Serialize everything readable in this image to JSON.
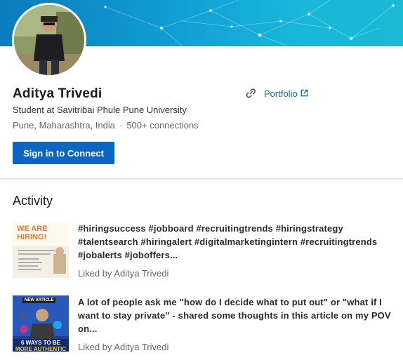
{
  "profile": {
    "name": "Aditya Trivedi",
    "headline": "Student at Savitribai Phule Pune University",
    "location": "Pune, Maharashtra, India",
    "separator": "·",
    "connections": "500+ connections",
    "portfolio_label": "Portfolio",
    "sign_in_label": "Sign in to Connect"
  },
  "activity": {
    "title": "Activity",
    "items": [
      {
        "text": "#hiringsuccess #jobboard #recruitingtrends #hiringstrategy #talentsearch #hiringalert #digitalmarketingintern #recruitingtrends #jobalerts #joboffers...",
        "liked_by": "Liked by Aditya Trivedi",
        "thumb_text": "WE ARE HIRING!"
      },
      {
        "text": "A lot of people ask me \"how do I decide what to put out\" or \"what if I want to stay private\" - shared some thoughts in this article on my POV on...",
        "liked_by": "Liked by Aditya Trivedi",
        "thumb_badge": "NEW ARTICLE",
        "thumb_caption_1": "6 WAYS TO BE",
        "thumb_caption_2": "MORE AUTHENTIC ON"
      }
    ]
  },
  "colors": {
    "brand_blue": "#0a66c2",
    "cover_dark": "#0b7cbd",
    "cover_light": "#1ab9d6"
  },
  "icons": [
    "link-icon",
    "external-link-icon"
  ]
}
